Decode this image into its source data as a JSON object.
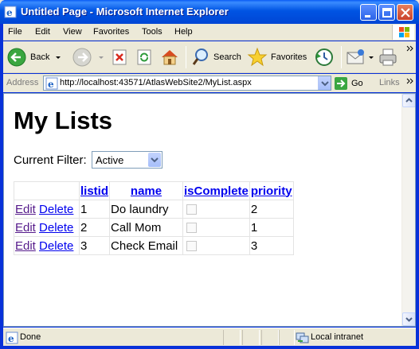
{
  "window": {
    "title": "Untitled Page - Microsoft Internet Explorer"
  },
  "menu": [
    "File",
    "Edit",
    "View",
    "Favorites",
    "Tools",
    "Help"
  ],
  "toolbar": {
    "back_label": "Back",
    "search_label": "Search",
    "favorites_label": "Favorites"
  },
  "address": {
    "label": "Address",
    "url": "http://localhost:43571/AtlasWebSite2/MyList.aspx",
    "go_label": "Go",
    "links_label": "Links"
  },
  "page": {
    "title": "My Lists",
    "filter_label": "Current Filter:",
    "filter_value": "Active",
    "grid": {
      "columns": [
        "",
        "listid",
        "name",
        "isComplete",
        "priority"
      ],
      "commands": {
        "edit": "Edit",
        "delete": "Delete"
      },
      "rows": [
        {
          "listid": "1",
          "name": "Do laundry",
          "isComplete": false,
          "priority": "2"
        },
        {
          "listid": "2",
          "name": "Call Mom",
          "isComplete": false,
          "priority": "1"
        },
        {
          "listid": "3",
          "name": "Check Email",
          "isComplete": false,
          "priority": "3"
        }
      ]
    }
  },
  "status": {
    "text": "Done",
    "zone": "Local intranet"
  },
  "colors": {
    "titlebar": "#0054e3",
    "link": "#0000ee",
    "visited_link": "#551a8b",
    "chrome": "#ece9d8"
  }
}
